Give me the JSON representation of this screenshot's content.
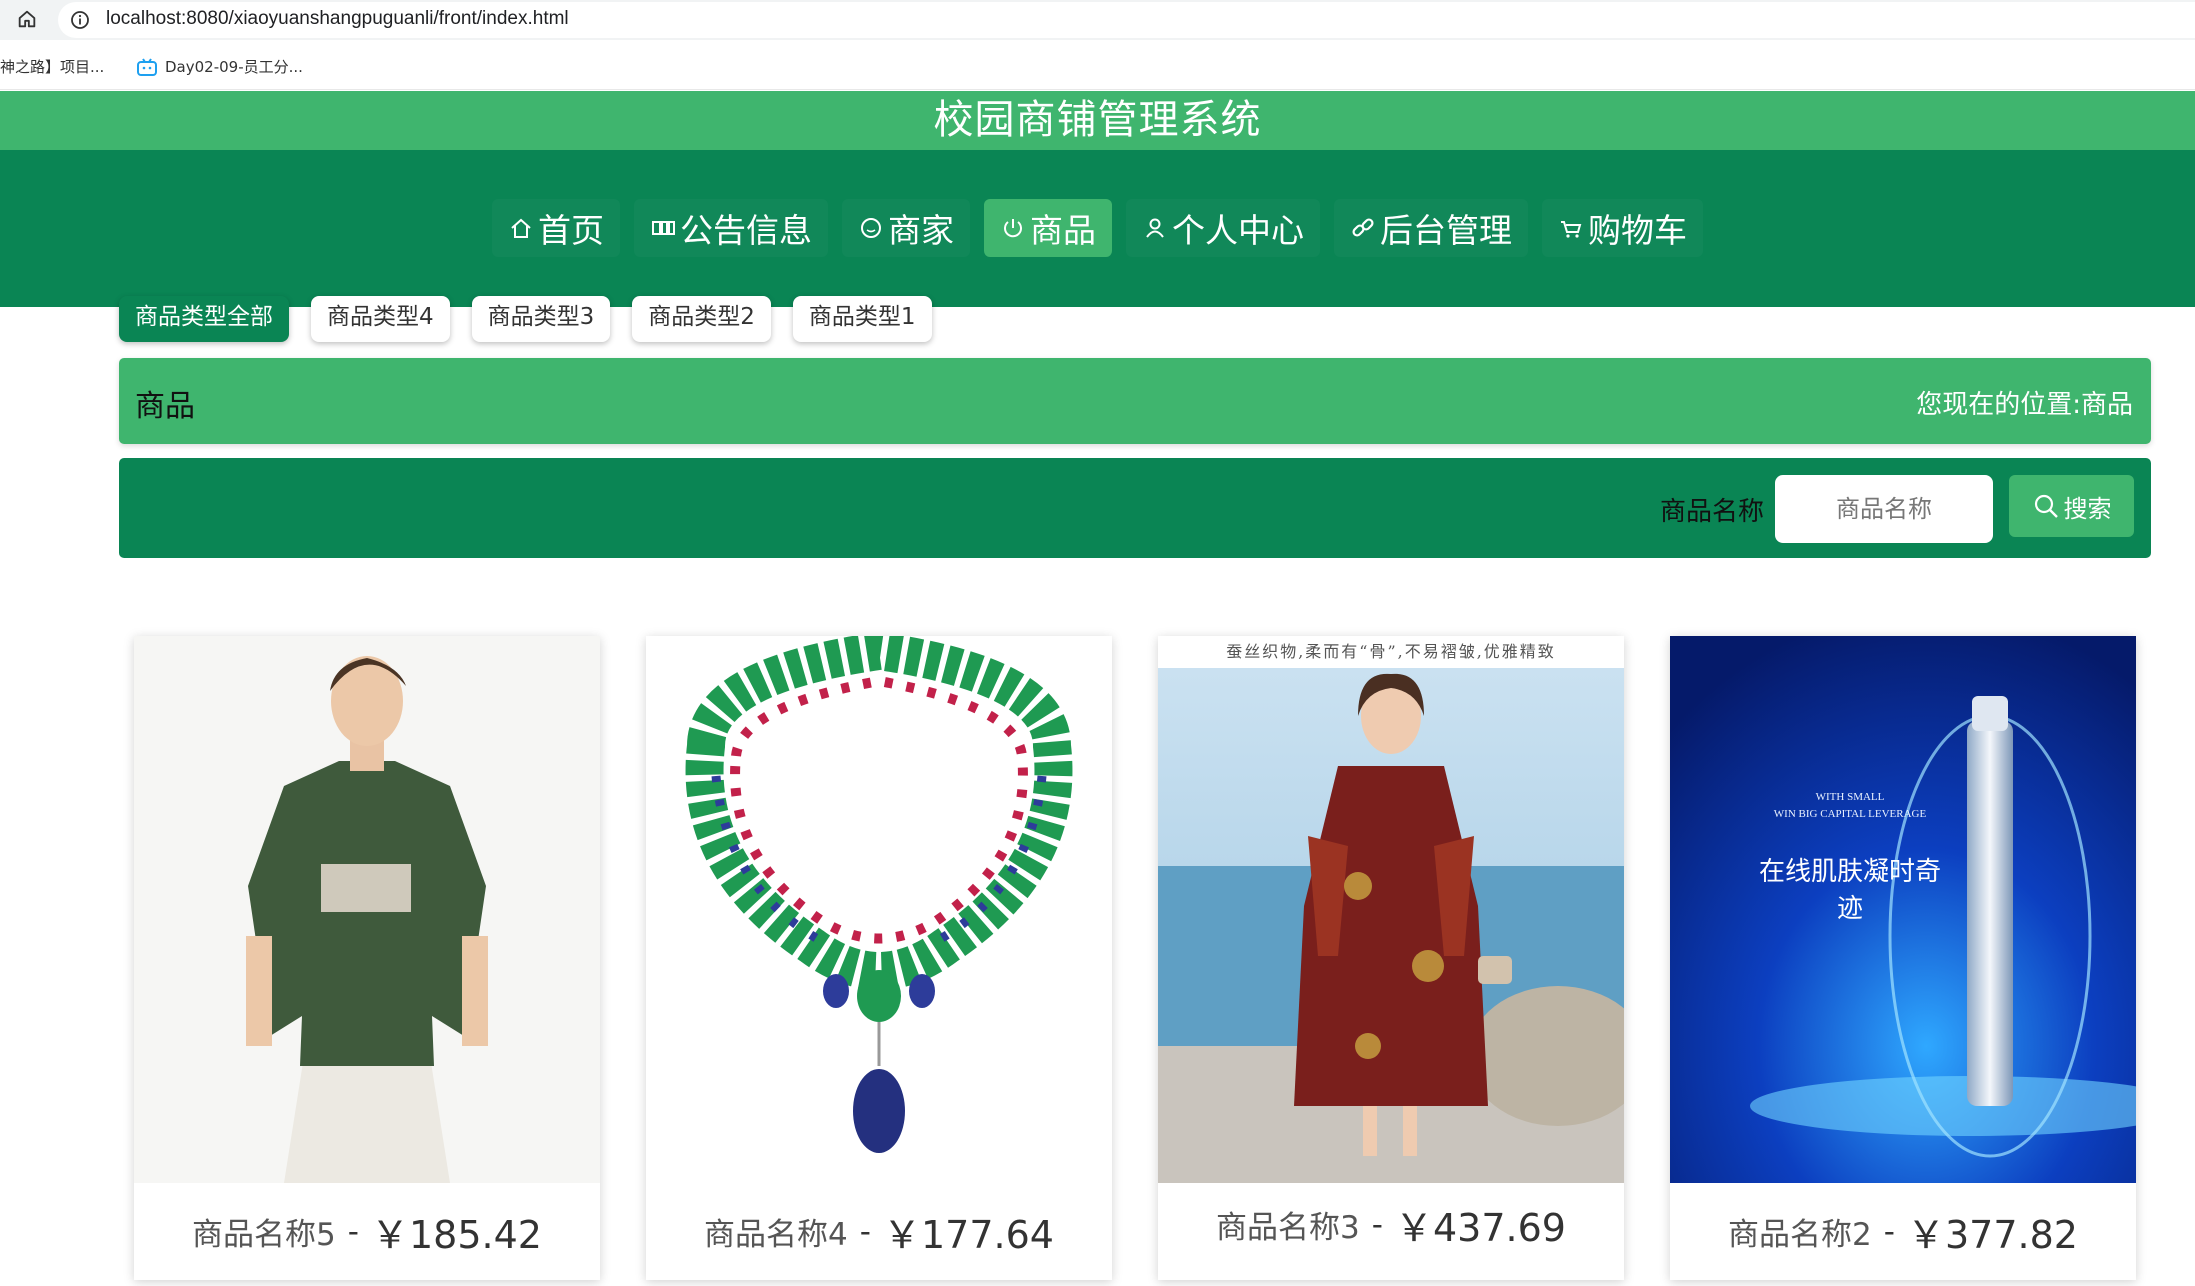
{
  "browser": {
    "url": "localhost:8080/xiaoyuanshangpuguanli/front/index.html",
    "bookmarks": [
      {
        "label": "神之路】项目..."
      },
      {
        "label": "Day02-09-员工分..."
      }
    ]
  },
  "header": {
    "title": "校园商铺管理系统"
  },
  "nav": {
    "items": [
      {
        "label": "首页",
        "icon": "home-icon"
      },
      {
        "label": "公告信息",
        "icon": "notice-icon"
      },
      {
        "label": "商家",
        "icon": "smile-icon"
      },
      {
        "label": "商品",
        "icon": "power-icon",
        "active": true
      },
      {
        "label": "个人中心",
        "icon": "user-icon"
      },
      {
        "label": "后台管理",
        "icon": "link-icon"
      },
      {
        "label": "购物车",
        "icon": "cart-icon"
      }
    ]
  },
  "categories": {
    "tabs": [
      {
        "label": "商品类型全部",
        "active": true
      },
      {
        "label": "商品类型4"
      },
      {
        "label": "商品类型3"
      },
      {
        "label": "商品类型2"
      },
      {
        "label": "商品类型1"
      }
    ]
  },
  "breadcrumb": {
    "title": "商品",
    "prefix": "您现在的位置:",
    "current": "商品"
  },
  "search": {
    "label": "商品名称",
    "placeholder": "商品名称",
    "button_label": "搜索"
  },
  "products": [
    {
      "name": "商品名称5",
      "dash": "-",
      "price": "￥185.42",
      "image": "green t-shirt model photo"
    },
    {
      "name": "商品名称4",
      "dash": "-",
      "price": "￥177.64",
      "image": "emerald necklace photo"
    },
    {
      "name": "商品名称3",
      "dash": "-",
      "price": "￥437.69",
      "image": "floral dress model photo",
      "banner": "蚕丝织物,柔而有“骨”,不易褶皱,优雅精致"
    },
    {
      "name": "商品名称2",
      "dash": "-",
      "price": "￥377.82",
      "image": "serum bottle ad",
      "ad_text": "在线肌肤凝时奇迹",
      "ad_tagline_1": "WITH SMALL",
      "ad_tagline_2": "WIN BIG CAPITAL LEVERAGE"
    }
  ],
  "colors": {
    "primary_dark": "#0a8554",
    "primary_light": "#3fb56e"
  }
}
